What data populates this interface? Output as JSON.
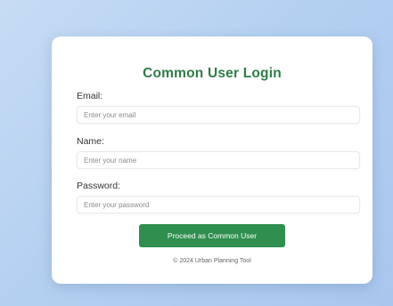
{
  "login": {
    "title": "Common User Login",
    "email_label": "Email:",
    "email_placeholder": "Enter your email",
    "email_value": "",
    "name_label": "Name:",
    "name_placeholder": "Enter your name",
    "name_value": "",
    "password_label": "Password:",
    "password_placeholder": "Enter your password",
    "password_value": "",
    "submit_label": "Proceed as Common User",
    "footer": "© 2024 Urban Planning Tool"
  },
  "colors": {
    "accent": "#2f8f4e",
    "title": "#2e7d46",
    "background": "#b4d0f1"
  }
}
